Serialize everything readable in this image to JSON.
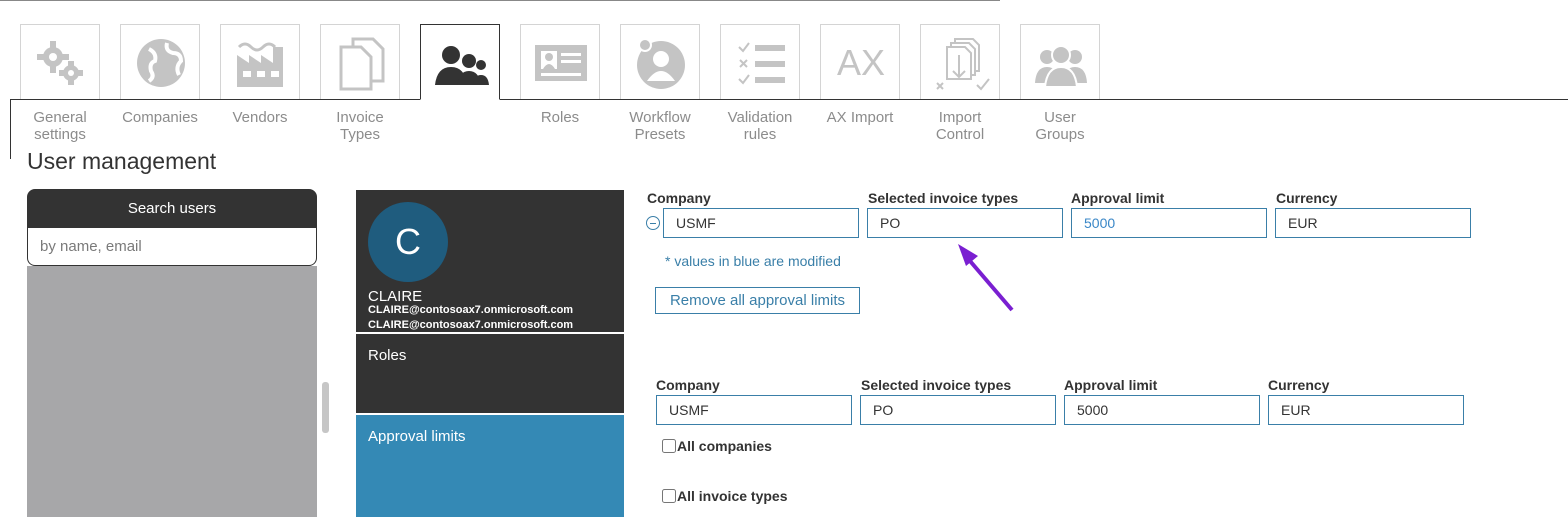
{
  "tabs": [
    {
      "id": "general",
      "label": "General\nsettings",
      "icon": "gears-icon"
    },
    {
      "id": "companies",
      "label": "Companies",
      "icon": "globe-icon"
    },
    {
      "id": "vendors",
      "label": "Vendors",
      "icon": "factory-icon"
    },
    {
      "id": "invoice-types",
      "label": "Invoice\nTypes",
      "icon": "documents-icon"
    },
    {
      "id": "user-management",
      "label": "",
      "icon": "users-icon",
      "active": true
    },
    {
      "id": "roles",
      "label": "Roles",
      "icon": "id-card-icon"
    },
    {
      "id": "workflow-presets",
      "label": "Workflow\nPresets",
      "icon": "user-circle-icon"
    },
    {
      "id": "validation-rules",
      "label": "Validation\nrules",
      "icon": "checklist-icon"
    },
    {
      "id": "ax-import",
      "label": "AX Import",
      "icon": "ax-icon",
      "icon_text": "AX"
    },
    {
      "id": "import-control",
      "label": "Import\nControl",
      "icon": "import-docs-icon"
    },
    {
      "id": "user-groups",
      "label": "User\nGroups",
      "icon": "user-group-icon"
    }
  ],
  "page": {
    "title": "User management"
  },
  "search": {
    "header": "Search users",
    "placeholder": "by name, email"
  },
  "user": {
    "initial": "C",
    "name": "CLAIRE",
    "emails": [
      "CLAIRE@contosoax7.onmicrosoft.com",
      "CLAIRE@contosoax7.onmicrosoft.com"
    ]
  },
  "menu": {
    "roles": "Roles",
    "approval_limits": "Approval limits"
  },
  "limits_header": {
    "company": "Company",
    "invoice_types": "Selected invoice types",
    "approval_limit": "Approval limit",
    "currency": "Currency"
  },
  "limit_row": {
    "company": "USMF",
    "invoice_types": "PO",
    "approval_limit": "5000",
    "currency": "EUR"
  },
  "modified_note": "* values in blue are modified",
  "remove_all_label": "Remove all approval limits",
  "new_limit": {
    "header": {
      "company": "Company",
      "invoice_types": "Selected invoice types",
      "approval_limit": "Approval limit",
      "currency": "Currency"
    },
    "company": "USMF",
    "invoice_types": "PO",
    "approval_limit": "5000",
    "currency": "EUR",
    "all_companies_label": "All companies",
    "all_invoice_types_label": "All invoice types"
  },
  "colors": {
    "dark": "#333333",
    "accent": "#3489b5",
    "modified": "#3a87c7",
    "annotation_arrow": "#7a1fd1",
    "avatar": "#1f5c7e"
  }
}
